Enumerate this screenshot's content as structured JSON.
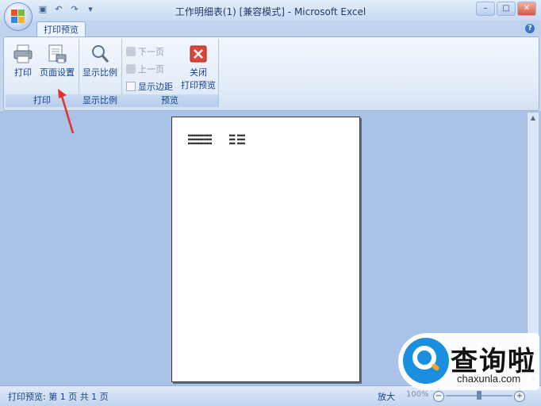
{
  "window": {
    "title": "工作明细表(1)  [兼容模式] - Microsoft Excel",
    "controls": [
      "–",
      "□",
      "✕"
    ]
  },
  "quick_access": {
    "save_icon": "save-icon",
    "undo_icon": "undo-icon",
    "redo_icon": "redo-icon",
    "customize": "▾"
  },
  "ribbon": {
    "active_tab": "打印预览",
    "groups": {
      "print": {
        "label": "打印",
        "print_button": "打印",
        "page_setup_button": "页面设置"
      },
      "zoom": {
        "label": "显示比例",
        "zoom_button": "显示比例"
      },
      "preview": {
        "label": "预览",
        "next_page": "下一页",
        "prev_page": "上一页",
        "show_margins": "显示边距",
        "close_line1": "关闭",
        "close_line2": "打印预览"
      }
    },
    "help": "?"
  },
  "preview_page": {
    "col1": [
      "■■■■■■■■■■■■",
      "■■■■■■■■■■■■",
      "■■■■■■■■■■■■"
    ],
    "col2": [
      "■■■ ■■■■",
      "■■■ ■■■■",
      "■■■ ■■■■"
    ]
  },
  "status_bar": {
    "text": "打印预览: 第 1 页  共 1 页",
    "zoom_label": "放大",
    "zoom_percent": "100%",
    "zoom_minus": "−",
    "zoom_plus": "+"
  },
  "watermark": {
    "cn": "查询啦",
    "en": "chaxunla.com"
  },
  "colors": {
    "accent": "#15428b",
    "annotation_arrow": "#e0332b",
    "workspace": "#a9c2e6"
  }
}
